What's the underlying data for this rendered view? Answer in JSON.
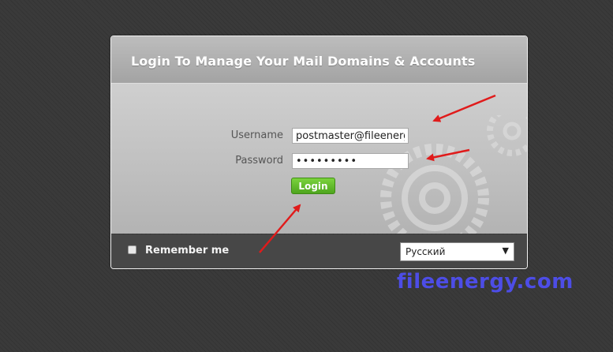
{
  "panel": {
    "title": "Login To Manage Your Mail Domains & Accounts"
  },
  "form": {
    "username_label": "Username",
    "username_value": "postmaster@fileenergy",
    "password_label": "Password",
    "password_value": "•••••••••",
    "login_label": "Login"
  },
  "footer": {
    "remember_label": "Remember me",
    "remember_checked": false,
    "language_selected": "Русский"
  },
  "watermark": "fileenergy.com",
  "colors": {
    "accent_green": "#5cb82a",
    "arrow_red": "#e01b1b",
    "watermark_blue": "#4d4de6",
    "footer_bg": "#474747"
  }
}
